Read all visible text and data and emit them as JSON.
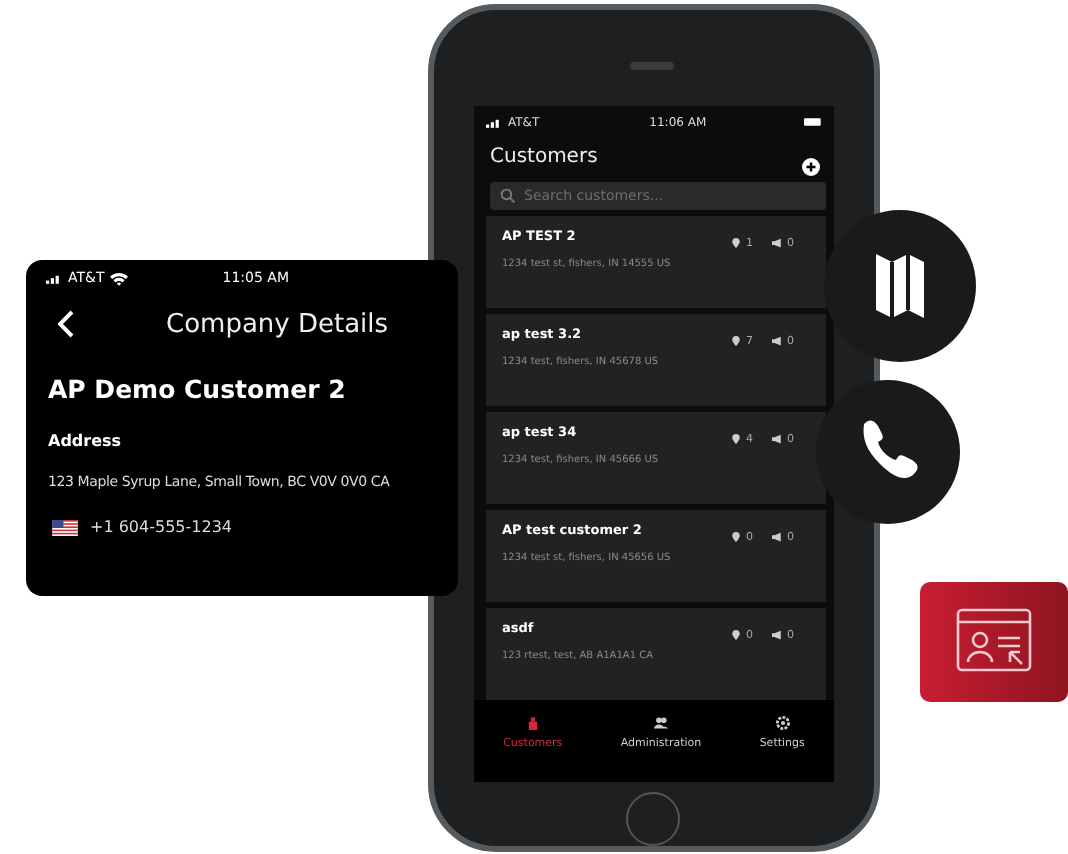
{
  "customers_screen": {
    "status_bar": {
      "carrier": "AT&T",
      "time": "11:06 AM"
    },
    "title": "Customers",
    "search": {
      "placeholder": "Search customers..."
    },
    "rows": [
      {
        "name": "AP TEST 2",
        "address": "1234 test st, fishers, IN 14555 US",
        "locations": "1",
        "contacts": "0"
      },
      {
        "name": "ap test 3.2",
        "address": "1234 test, fishers, IN 45678 US",
        "locations": "7",
        "contacts": "0"
      },
      {
        "name": "ap test 34",
        "address": "1234 test, fishers, IN 45666 US",
        "locations": "4",
        "contacts": "0"
      },
      {
        "name": "AP test customer 2",
        "address": "1234 test st, fishers, IN 45656 US",
        "locations": "0",
        "contacts": "0"
      },
      {
        "name": "asdf",
        "address": "123 rtest, test, AB A1A1A1 CA",
        "locations": "0",
        "contacts": "0"
      }
    ],
    "tabs": [
      {
        "label": "Customers",
        "selected": true,
        "kind": "customers"
      },
      {
        "label": "Administration",
        "selected": false,
        "kind": "admin"
      },
      {
        "label": "Settings",
        "selected": false,
        "kind": "settings"
      }
    ]
  },
  "details_screen": {
    "status_bar": {
      "carrier": "AT&T",
      "time": "11:05 AM"
    },
    "title": "Company Details",
    "company": "AP Demo Customer 2",
    "address_label": "Address",
    "address": "123 Maple Syrup Lane, Small Town, BC V0V 0V0 CA",
    "phone": "+1 604-555-1234"
  }
}
